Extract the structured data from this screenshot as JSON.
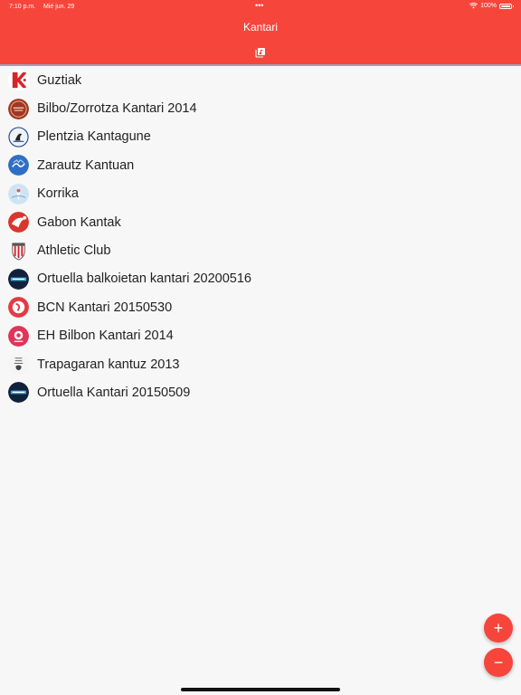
{
  "status": {
    "time": "7:10 p.m.",
    "date": "Mié jun. 29",
    "dots": "•••",
    "battery": "100%"
  },
  "header": {
    "title": "Kantari"
  },
  "list": {
    "items": [
      {
        "label": "Guztiak",
        "icon": "k-logo-icon"
      },
      {
        "label": "Bilbo/Zorrotza Kantari 2014",
        "icon": "bilbo-zorrotza-badge-icon"
      },
      {
        "label": "Plentzia Kantagune",
        "icon": "plentzia-badge-icon"
      },
      {
        "label": "Zarautz Kantuan",
        "icon": "zarautz-badge-icon"
      },
      {
        "label": "Korrika",
        "icon": "korrika-badge-icon"
      },
      {
        "label": "Gabon Kantak",
        "icon": "gabon-badge-icon"
      },
      {
        "label": "Athletic Club",
        "icon": "athletic-club-crest-icon"
      },
      {
        "label": "Ortuella balkoietan kantari 20200516",
        "icon": "ortuella-badge-icon"
      },
      {
        "label": "BCN Kantari 20150530",
        "icon": "bcn-badge-icon"
      },
      {
        "label": "EH Bilbon Kantari 2014",
        "icon": "eh-bilbon-badge-icon"
      },
      {
        "label": "Trapagaran kantuz 2013",
        "icon": "trapagaran-badge-icon"
      },
      {
        "label": "Ortuella Kantari 20150509",
        "icon": "ortuella-kantari-badge-icon"
      }
    ]
  },
  "fab": {
    "add": "+",
    "remove": "−"
  },
  "colors": {
    "accent": "#f6453b",
    "header_border": "#9aa3c8"
  }
}
